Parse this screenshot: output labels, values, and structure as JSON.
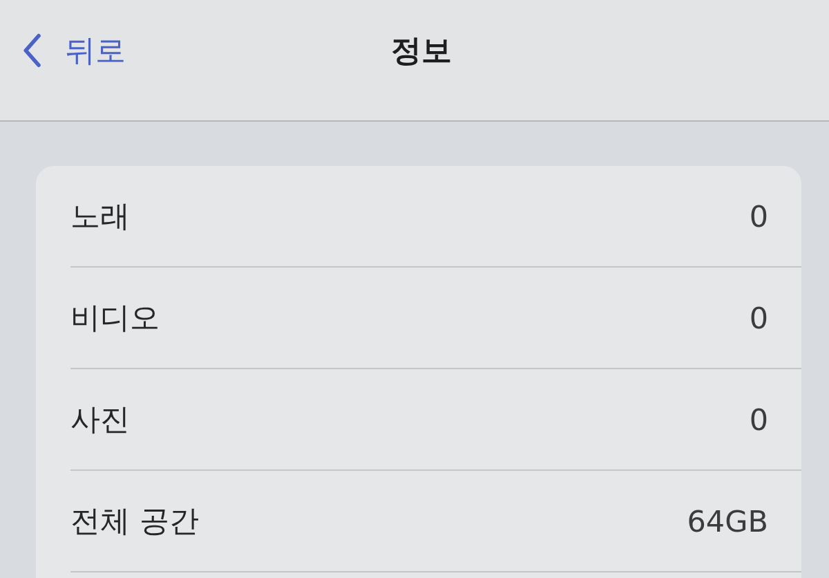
{
  "nav_bar": {
    "back": "뒤로",
    "title": "정보"
  },
  "rows": [
    {
      "label": "노래",
      "value": "0"
    },
    {
      "label": "비디오",
      "value": "0"
    },
    {
      "label": "사진",
      "value": "0"
    },
    {
      "label": "전체 공간",
      "value": "64GB"
    }
  ]
}
